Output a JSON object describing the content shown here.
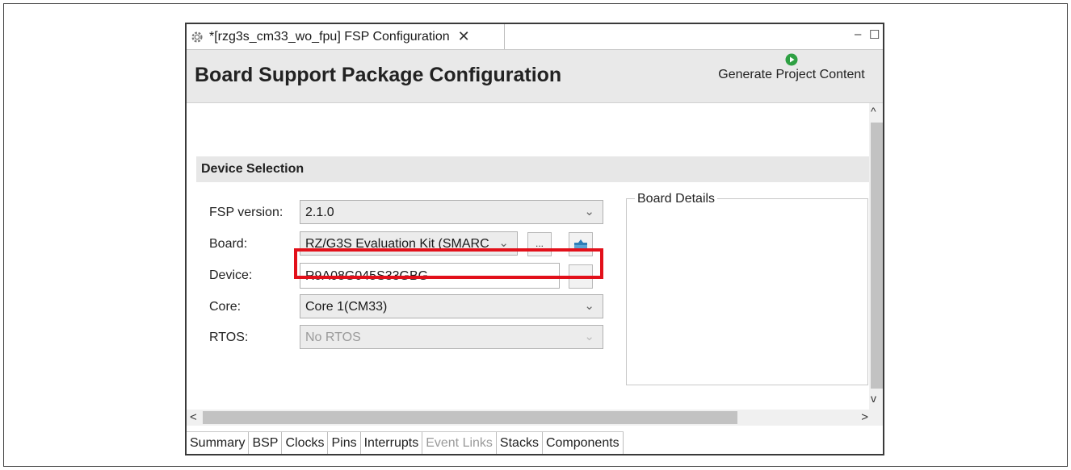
{
  "editor_tab": {
    "title": "*[rzg3s_cm33_wo_fpu] FSP Configuration",
    "close_glyph": "✕",
    "icon": "gear-icon"
  },
  "window_controls": {
    "minimize_glyph": "–",
    "maximize_glyph": "☐"
  },
  "header": {
    "title": "Board Support Package Configuration",
    "generate_label": "Generate Project Content",
    "generate_icon": "play-icon",
    "accent": "#2ea043"
  },
  "device_selection": {
    "section_title": "Device Selection",
    "fsp_version": {
      "label": "FSP version:",
      "value": "2.1.0"
    },
    "board": {
      "label": "Board:",
      "value": "RZ/G3S Evaluation Kit (SMARC",
      "browse_label": "...",
      "import_icon": "import-icon"
    },
    "device": {
      "label": "Device:",
      "value": "R9A08G045S33GBG",
      "browse_label": "..."
    },
    "core": {
      "label": "Core:",
      "value": "Core 1(CM33)"
    },
    "rtos": {
      "label": "RTOS:",
      "value": "No RTOS"
    },
    "highlight_color": "#e2101a"
  },
  "board_details": {
    "label": "Board Details"
  },
  "scroll": {
    "up": "^",
    "down": "v",
    "left": "<",
    "right": ">"
  },
  "bottom_tabs": [
    "Summary",
    "BSP",
    "Clocks",
    "Pins",
    "Interrupts",
    "Event Links",
    "Stacks",
    "Components"
  ]
}
